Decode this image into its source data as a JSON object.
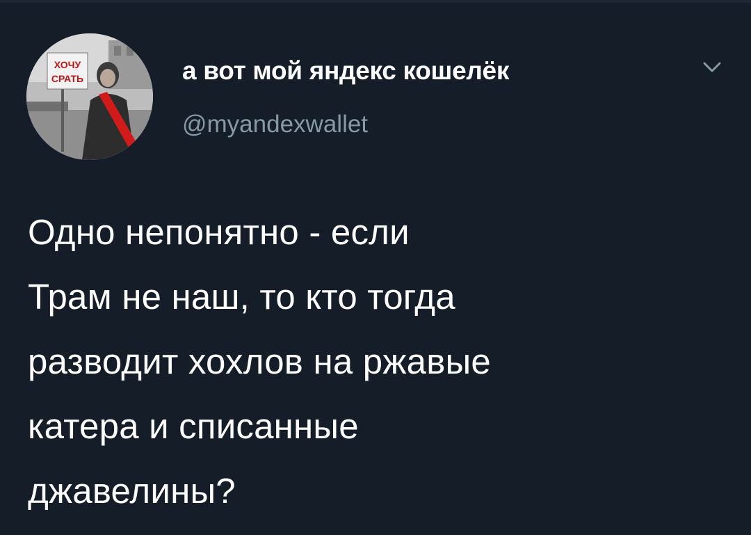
{
  "tweet": {
    "author": {
      "display_name": "а вот мой яндекс кошелёк",
      "handle": "@myandexwallet",
      "avatar_sign_text": "ХОЧУ СРАТЬ"
    },
    "menu_icon": "chevron-down-icon",
    "text": "Одно непонятно - если\nТрам не наш, то кто тогда\nразводит хохлов на ржавые\nкатера и списанные\nджавелины?"
  },
  "colors": {
    "background": "#151d28",
    "text_primary": "#ffffff",
    "text_secondary": "#8899a6"
  }
}
